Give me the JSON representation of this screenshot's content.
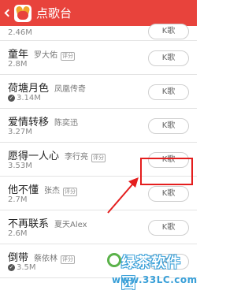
{
  "header": {
    "title": "点歌台"
  },
  "songs": [
    {
      "title": "",
      "artist": "",
      "size": "2.46M",
      "verified": false,
      "review": "",
      "k_label": "K歌"
    },
    {
      "title": "童年",
      "artist": "罗大佑",
      "size": "2.8M",
      "verified": false,
      "review": "评分",
      "k_label": "K歌"
    },
    {
      "title": "荷塘月色",
      "artist": "凤凰传奇",
      "size": "3.14M",
      "verified": true,
      "review": "",
      "k_label": "K歌"
    },
    {
      "title": "爱情转移",
      "artist": "陈奕迅",
      "size": "3.27M",
      "verified": false,
      "review": "",
      "k_label": "K歌"
    },
    {
      "title": "愿得一人心",
      "artist": "李行亮",
      "size": "3.53M",
      "verified": false,
      "review": "评分",
      "k_label": "K歌"
    },
    {
      "title": "他不懂",
      "artist": "张杰",
      "size": "2.7M",
      "verified": false,
      "review": "评分",
      "k_label": "K歌"
    },
    {
      "title": "不再联系",
      "artist": "夏天Alex",
      "size": "2.6M",
      "verified": false,
      "review": "",
      "k_label": "K歌"
    },
    {
      "title": "倒带",
      "artist": "蔡依林",
      "size": "3.5M",
      "verified": true,
      "review": "评分",
      "k_label": "K歌"
    }
  ],
  "watermark": {
    "name": "绿茶软件园",
    "url": "www.33LC.com"
  },
  "colors": {
    "header": "#e8433c",
    "highlight": "#e41e1e"
  }
}
